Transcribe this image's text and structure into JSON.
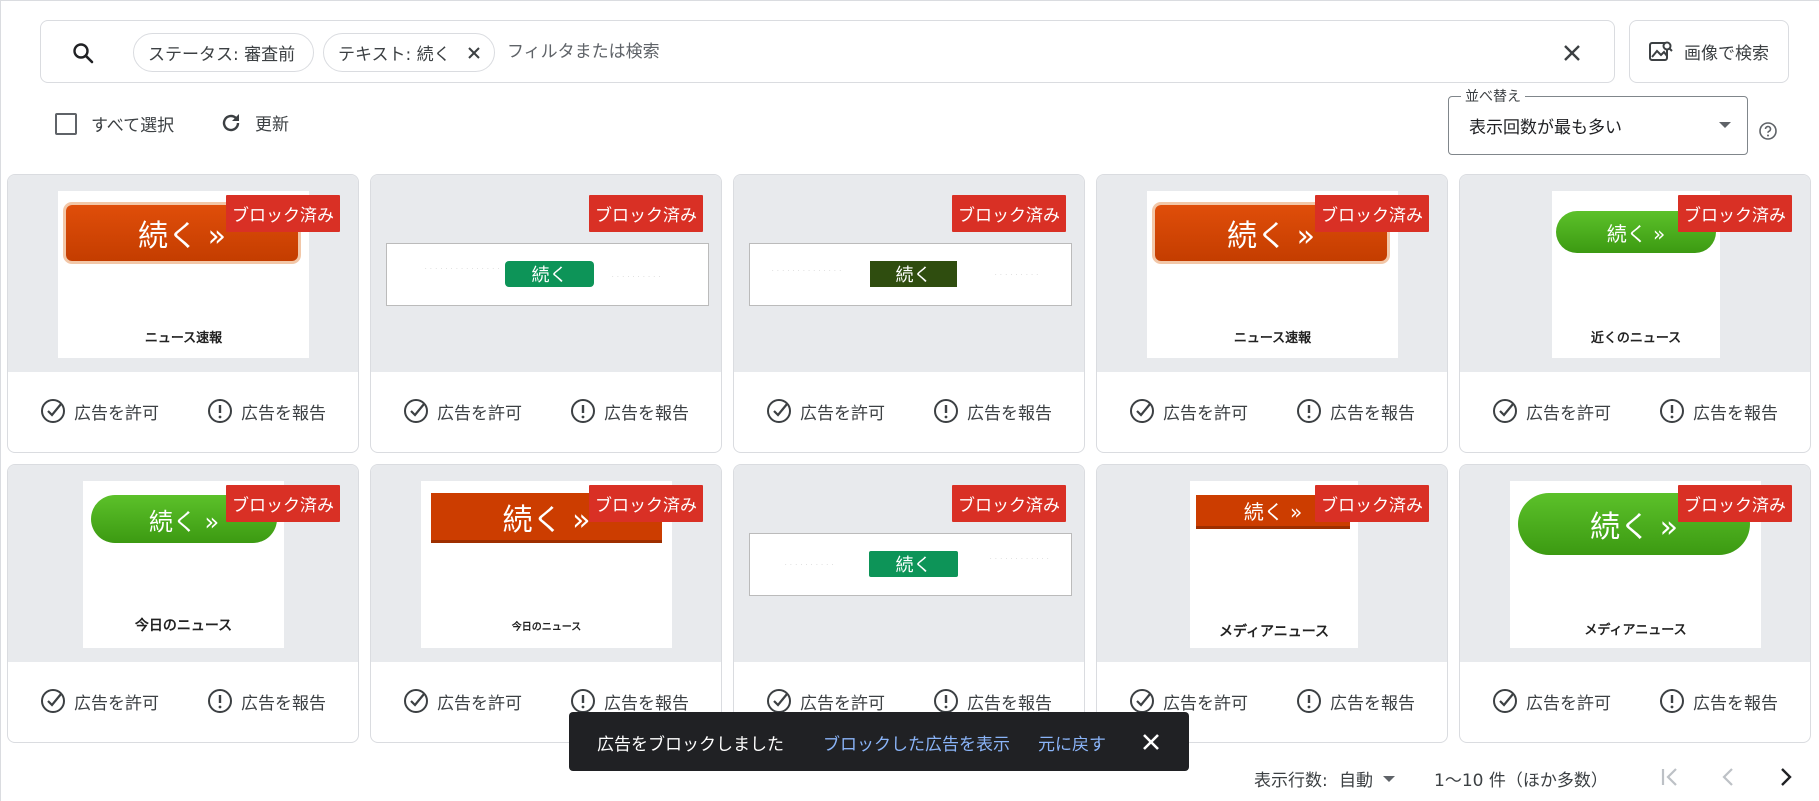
{
  "search": {
    "chips": [
      {
        "label": "ステータス: 審査前"
      },
      {
        "label": "テキスト: 続く"
      }
    ],
    "placeholder": "フィルタまたは検索",
    "image_search_label": "画像で検索"
  },
  "toolbar": {
    "select_all_label": "すべて選択",
    "refresh_label": "更新",
    "sort_label": "並べ替え",
    "sort_value": "表示回数が最も多い"
  },
  "cards": {
    "badge": "ブロック済み",
    "allow_label": "広告を許可",
    "report_label": "広告を報告",
    "items": [
      {
        "cta": "続く »",
        "caption": "ニュース速報"
      },
      {
        "cta": "続く",
        "caption": ""
      },
      {
        "cta": "続く",
        "caption": ""
      },
      {
        "cta": "続く »",
        "caption": "ニュース速報"
      },
      {
        "cta": "続く »",
        "caption": "近くのニュース"
      },
      {
        "cta": "続く »",
        "caption": "今日のニュース"
      },
      {
        "cta": "続く »",
        "caption": "今日のニュース"
      },
      {
        "cta": "続く",
        "caption": ""
      },
      {
        "cta": "続く »",
        "caption": "メディアニュース"
      },
      {
        "cta": "続く »",
        "caption": "メディアニュース"
      }
    ]
  },
  "snackbar": {
    "message": "広告をブロックしました",
    "view_blocked_link": "ブロックした広告を表示",
    "undo_link": "元に戻す"
  },
  "pagination": {
    "rows_label": "表示行数:",
    "rows_value": "自動",
    "range": "1〜10 件（ほか多数）"
  },
  "colors": {
    "badge_red": "#d93025",
    "link_blue": "#8ab4f8",
    "snackbar_bg": "#202124",
    "preview_bg": "#e8eaed"
  }
}
